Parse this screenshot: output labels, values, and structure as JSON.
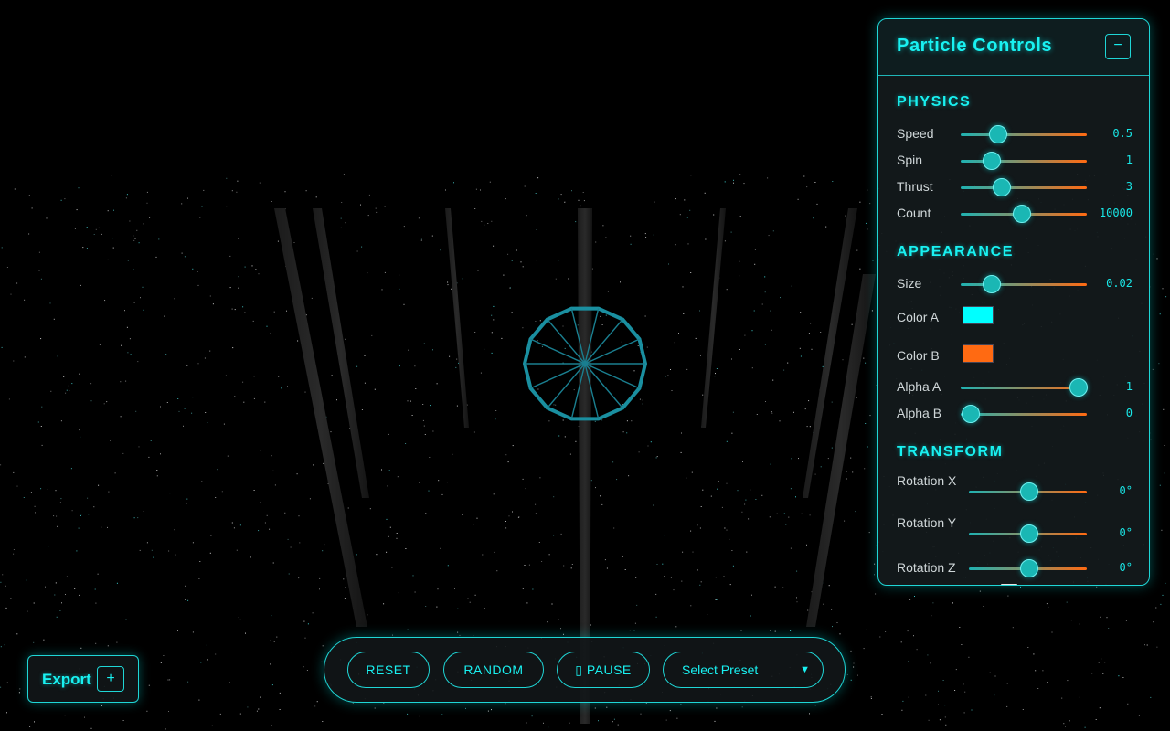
{
  "panel": {
    "title": "Particle Controls",
    "collapse_label": "−",
    "sections": {
      "physics": {
        "title": "PHYSICS",
        "controls": [
          {
            "label": "Speed",
            "value": "0.5",
            "fraction": 0.29
          },
          {
            "label": "Spin",
            "value": "1",
            "fraction": 0.24
          },
          {
            "label": "Thrust",
            "value": "3",
            "fraction": 0.32
          },
          {
            "label": "Count",
            "value": "10000",
            "fraction": 0.48
          }
        ]
      },
      "appearance": {
        "title": "APPEARANCE",
        "size": {
          "label": "Size",
          "value": "0.02",
          "fraction": 0.24
        },
        "color_a": {
          "label": "Color A",
          "color": "#00ffff"
        },
        "color_b": {
          "label": "Color B",
          "color": "#ff6a12"
        },
        "alpha_a": {
          "label": "Alpha A",
          "value": "1",
          "fraction": 0.93
        },
        "alpha_b": {
          "label": "Alpha B",
          "value": "0",
          "fraction": 0.07
        }
      },
      "transform": {
        "title": "TRANSFORM",
        "controls": [
          {
            "label": "Rotation X",
            "value": "0°",
            "fraction": 0.5
          },
          {
            "label": "Rotation Y",
            "value": "0°",
            "fraction": 0.5
          },
          {
            "label": "Rotation Z",
            "value": "0°",
            "fraction": 0.5
          }
        ]
      }
    }
  },
  "toolbar": {
    "reset_label": "RESET",
    "random_label": "RANDOM",
    "pause_label": "▯ PAUSE",
    "preset_value": "Select Preset"
  },
  "export": {
    "label": "Export",
    "plus_label": "+"
  },
  "colors": {
    "accent": "#19f1f1",
    "gradient_end": "#ff6a12"
  }
}
